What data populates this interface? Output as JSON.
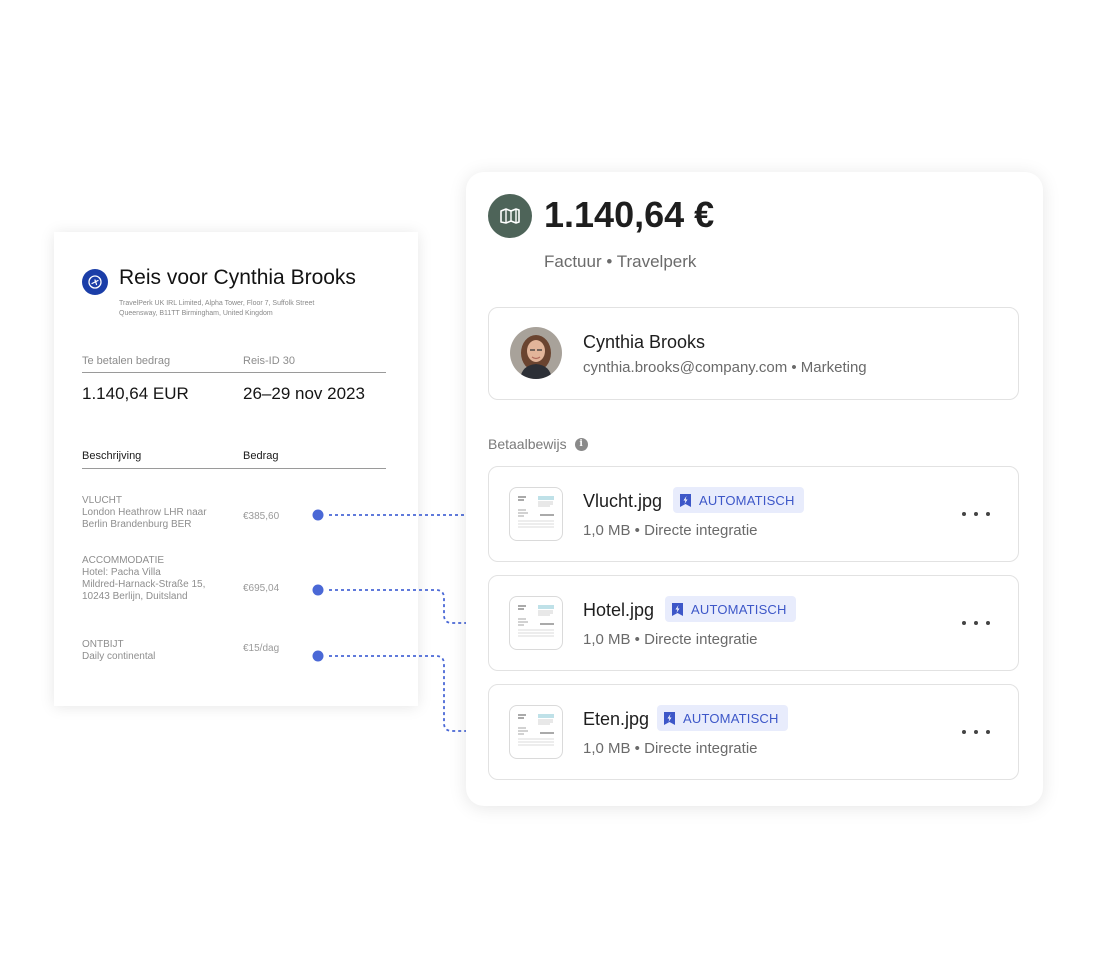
{
  "invoice": {
    "title": "Reis voor Cynthia Brooks",
    "address_line1": "TravelPerk UK IRL Limited, Alpha Tower, Floor 7, Suffolk Street",
    "address_line2": "Queensway, B11TT Birmingham, United Kingdom",
    "amount_label": "Te betalen bedrag",
    "amount_value": "1.140,64 EUR",
    "trip_label": "Reis-ID 30",
    "trip_dates": "26–29 nov 2023",
    "col_description": "Beschrijving",
    "col_amount": "Bedrag",
    "items": [
      {
        "category": "VLUCHT",
        "line1": "London Heathrow LHR naar",
        "line2": "Berlin Brandenburg BER",
        "line3": "",
        "amount": "€385,60"
      },
      {
        "category": "ACCOMMODATIE",
        "line1": "Hotel: Pacha Villa",
        "line2": "Mildred-Harnack-Straße 15,",
        "line3": "10243 Berlijn, Duitsland",
        "amount": "€695,04"
      },
      {
        "category": "ONTBIJT",
        "line1": "Daily continental",
        "line2": "",
        "line3": "",
        "amount": "€15/dag"
      }
    ]
  },
  "expense": {
    "amount": "1.140,64 €",
    "subtitle": "Factuur • Travelperk",
    "user": {
      "name": "Cynthia Brooks",
      "meta": "cynthia.brooks@company.com • Marketing"
    },
    "section_label": "Betaalbewijs",
    "receipts": [
      {
        "name": "Vlucht.jpg",
        "badge": "AUTOMATISCH",
        "meta": "1,0 MB • Directe integratie"
      },
      {
        "name": "Hotel.jpg",
        "badge": "AUTOMATISCH",
        "meta": "1,0 MB • Directe integratie"
      },
      {
        "name": "Eten.jpg",
        "badge": "AUTOMATISCH",
        "meta": "1,0 MB • Directe integratie"
      }
    ]
  },
  "colors": {
    "accent": "#3d57c8",
    "connector": "#4a68d6",
    "vendor_logo": "#4e6459",
    "invoice_logo": "#1b3ea8"
  },
  "icons": {
    "vendor_logo": "map-icon",
    "invoice_logo": "plane-icon",
    "badge": "bolt-bookmark-icon",
    "info": "info-icon",
    "more": "more-horizontal-icon"
  }
}
